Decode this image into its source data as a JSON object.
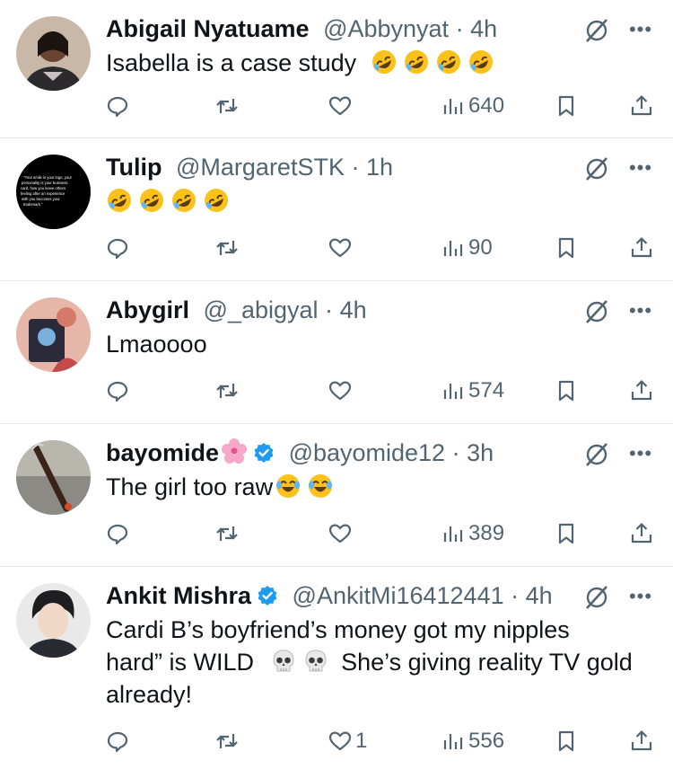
{
  "tweets": [
    {
      "name": "Abigail  Nyatuame",
      "handle": "@Abbynyat",
      "dot": "·",
      "time": "4h",
      "text": "Isabella is a case study",
      "emoji": [
        "rofl-emoji",
        "rofl-emoji",
        "rofl-emoji",
        "rofl-emoji"
      ],
      "views": "640",
      "likes": "",
      "verified": false
    },
    {
      "name": "Tulip",
      "handle": "@MargaretSTK",
      "dot": "·",
      "time": "1h",
      "text": "",
      "emoji": [
        "rofl-emoji",
        "rofl-emoji",
        "rofl-emoji",
        "rofl-emoji"
      ],
      "views": "90",
      "likes": "",
      "verified": false,
      "avatar_text": [
        "\"Your smile is your logo, your",
        "personality is your business",
        "card, how you leave others",
        "feeling after an experience",
        "with you becomes your",
        "trademark.\""
      ]
    },
    {
      "name": "Abygirl",
      "handle": "@_abigyal",
      "dot": "·",
      "time": "4h",
      "text": "Lmaoooo",
      "emoji": [],
      "views": "574",
      "likes": "",
      "verified": false
    },
    {
      "name": "bayomide",
      "handle": "@bayomide12",
      "dot": "·",
      "time": "3h",
      "text": "The girl too raw",
      "emoji": [
        "joy-emoji",
        "joy-emoji"
      ],
      "views": "389",
      "likes": "",
      "verified": true
    },
    {
      "name": "Ankit Mishra",
      "handle": "@AnkitMi16412441",
      "dot": "·",
      "time": "4h",
      "text_lines": [
        "Cardi B’s boyfriend’s money got my nipples",
        "hard” is WILD",
        "She’s giving reality TV gold",
        "already!"
      ],
      "views": "556",
      "likes": "1",
      "verified": true
    }
  ],
  "colors": {
    "text": "#0f1419",
    "muted": "#536471",
    "verified": "#1d9bf0",
    "divider": "#e6e9ec"
  },
  "more_label": "•••"
}
